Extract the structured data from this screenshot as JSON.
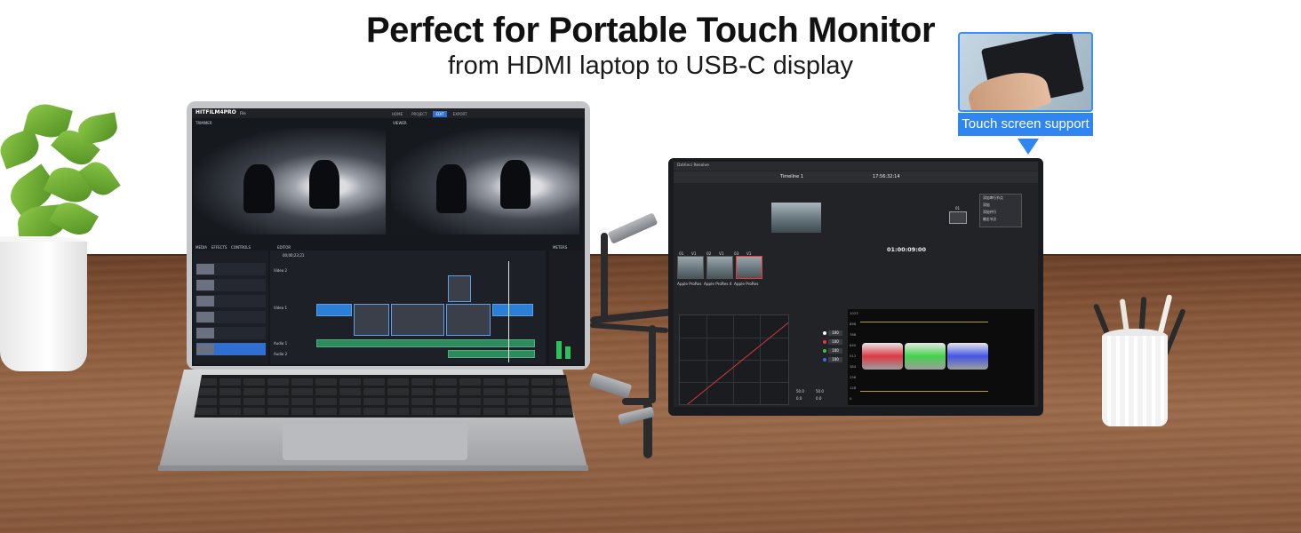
{
  "headline": "Perfect for Portable Touch Monitor",
  "subheadline": "from HDMI laptop to USB-C display",
  "badge": {
    "label": "Touch screen support",
    "color": "#2f86f0"
  },
  "colors": {
    "badge_blue": "#2f86f0",
    "desk": "#875638",
    "headline": "#111111"
  },
  "laptop_screen": {
    "app_logo": "HITFILM4PRO",
    "menu": [
      "File"
    ],
    "tabs": [
      "HOME",
      "PROJECT",
      "EDIT",
      "EXPORT"
    ],
    "active_tab": "EDIT",
    "panels": [
      "TRIMMER",
      "VIEWER",
      "MEDIA",
      "EFFECTS",
      "CONTROLS",
      "EDITOR",
      "METERS"
    ],
    "timecode": "00;00;23;21",
    "tracks": [
      "Video 2",
      "Video 1",
      "Audio 1",
      "Audio 2"
    ]
  },
  "monitor_screen": {
    "app_name": "DaVinci Resolve",
    "timeline_name": "Timeline 1",
    "toolbar_timecode": "17:56:32:14",
    "viewer_timecode": "01:00:09:00",
    "clip_numbers": [
      "01",
      "02",
      "03"
    ],
    "clip_tracks": [
      "V1",
      "V1",
      "V1"
    ],
    "clip_labels": [
      "Apple ProRes",
      "Apple ProRes 4",
      "Apple ProRes"
    ],
    "param_values": [
      "100",
      "100",
      "100",
      "100"
    ],
    "readouts": [
      "50.0",
      "50.0",
      "0.0",
      "0.0"
    ],
    "scope_ticks": [
      "1023",
      "896",
      "768",
      "640",
      "512",
      "384",
      "256",
      "128",
      "0"
    ],
    "context_menu": [
      "添加串行节点",
      "添加",
      "添加并行",
      "输出节点"
    ],
    "node_label": "01"
  }
}
